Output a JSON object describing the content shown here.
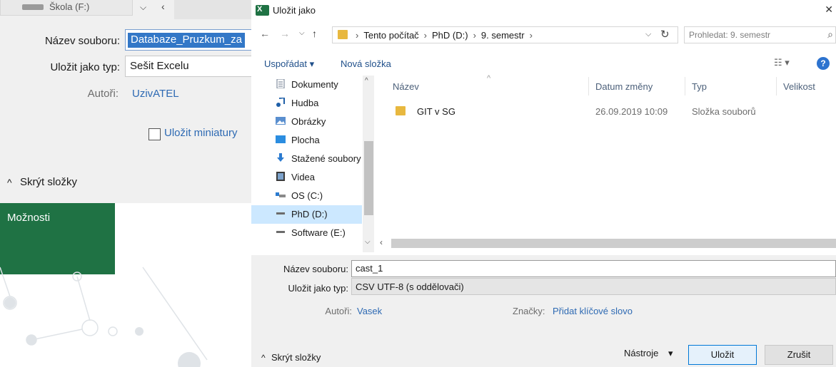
{
  "bg_dialog": {
    "strip_label": "Škola (F:)",
    "file_name_label": "Název souboru:",
    "file_name_value": "Databaze_Pruzkum_za",
    "save_type_label": "Uložit jako typ:",
    "save_type_value": "Sešit Excelu",
    "authors_label": "Autoři:",
    "authors_value": "UzivATEL",
    "thumbnail_label": "Uložit miniatury",
    "hide_folders_label": "Skrýt složky",
    "options_label": "Možnosti"
  },
  "dialog": {
    "title": "Uložit jako",
    "breadcrumbs": [
      "Tento počítač",
      "PhD (D:)",
      "9. semestr"
    ],
    "search_placeholder": "Prohledat: 9. semestr",
    "toolbar": {
      "organize": "Uspořádat ▾",
      "new_folder": "Nová složka"
    },
    "nav_items": [
      {
        "label": "Dokumenty",
        "icon": "documents-icon"
      },
      {
        "label": "Hudba",
        "icon": "music-icon"
      },
      {
        "label": "Obrázky",
        "icon": "pictures-icon"
      },
      {
        "label": "Plocha",
        "icon": "desktop-icon"
      },
      {
        "label": "Stažené soubory",
        "icon": "downloads-icon"
      },
      {
        "label": "Videa",
        "icon": "videos-icon"
      },
      {
        "label": "OS (C:)",
        "icon": "drive-c-icon"
      },
      {
        "label": "PhD (D:)",
        "icon": "drive-d-icon",
        "selected": true
      },
      {
        "label": "Software (E:)",
        "icon": "drive-e-icon"
      }
    ],
    "columns": [
      "Název",
      "Datum změny",
      "Typ",
      "Velikost"
    ],
    "rows": [
      {
        "name": "GIT v SG",
        "date": "26.09.2019 10:09",
        "type": "Složka souborů",
        "size": ""
      }
    ],
    "form": {
      "file_name_label": "Název souboru:",
      "file_name_value": "cast_1",
      "save_type_label": "Uložit jako typ:",
      "save_type_value": "CSV UTF-8 (s oddělovači)",
      "authors_label": "Autoři:",
      "authors_value": "Vasek",
      "tags_label": "Značky:",
      "tags_value": "Přidat klíčové slovo",
      "hide_folders_label": "Skrýt složky",
      "tools_label": "Nástroje",
      "save_label": "Uložit",
      "cancel_label": "Zrušit"
    }
  },
  "colors": {
    "excel_green": "#1f7244",
    "selection": "#3277c7",
    "link": "#2e6ab3",
    "folder": "#e8b83f",
    "nav_selected": "#cce8ff"
  }
}
